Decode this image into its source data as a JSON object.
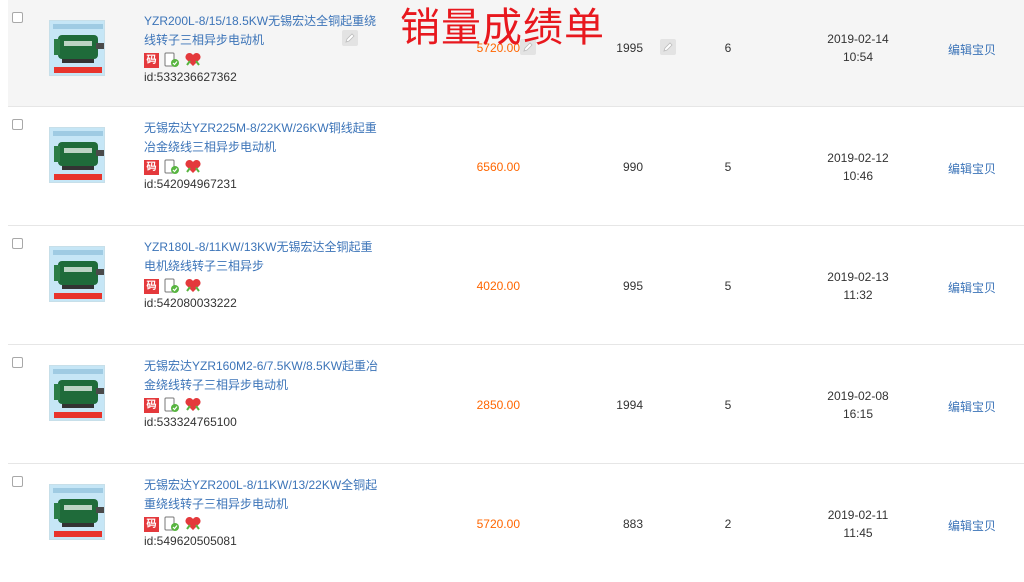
{
  "overlay_title": "销量成绩单",
  "edit_label": "编辑宝贝",
  "badge_code": "码",
  "products": [
    {
      "title": "YZR200L-8/15/18.5KW无锡宏达全铜起重绕线转子三相异步电动机",
      "id": "id:533236627362",
      "price": "5720.00",
      "stock": "1995",
      "sales": "6",
      "date": "2019-02-14",
      "time": "10:54"
    },
    {
      "title": "无锡宏达YZR225M-8/22KW/26KW铜线起重冶金绕线三相异步电动机",
      "id": "id:542094967231",
      "price": "6560.00",
      "stock": "990",
      "sales": "5",
      "date": "2019-02-12",
      "time": "10:46"
    },
    {
      "title": "YZR180L-8/11KW/13KW无锡宏达全铜起重电机绕线转子三相异步",
      "id": "id:542080033222",
      "price": "4020.00",
      "stock": "995",
      "sales": "5",
      "date": "2019-02-13",
      "time": "11:32"
    },
    {
      "title": "无锡宏达YZR160M2-6/7.5KW/8.5KW起重冶金绕线转子三相异步电动机",
      "id": "id:533324765100",
      "price": "2850.00",
      "stock": "1994",
      "sales": "5",
      "date": "2019-02-08",
      "time": "16:15"
    },
    {
      "title": "无锡宏达YZR200L-8/11KW/13/22KW全铜起重绕线转子三相异步电动机",
      "id": "id:549620505081",
      "price": "5720.00",
      "stock": "883",
      "sales": "2",
      "date": "2019-02-11",
      "time": "11:45"
    }
  ],
  "icons": {
    "checkbox": "checkbox-icon",
    "thumbnail": "motor-thumbnail",
    "phone": "mobile-check-icon",
    "heart": "heart-icon",
    "pen": "pencil-edit-icon"
  },
  "colors": {
    "link": "#3c74b8",
    "price": "#ff6600",
    "overlay": "#e8181e",
    "hover_row": "#f5f5f5"
  }
}
